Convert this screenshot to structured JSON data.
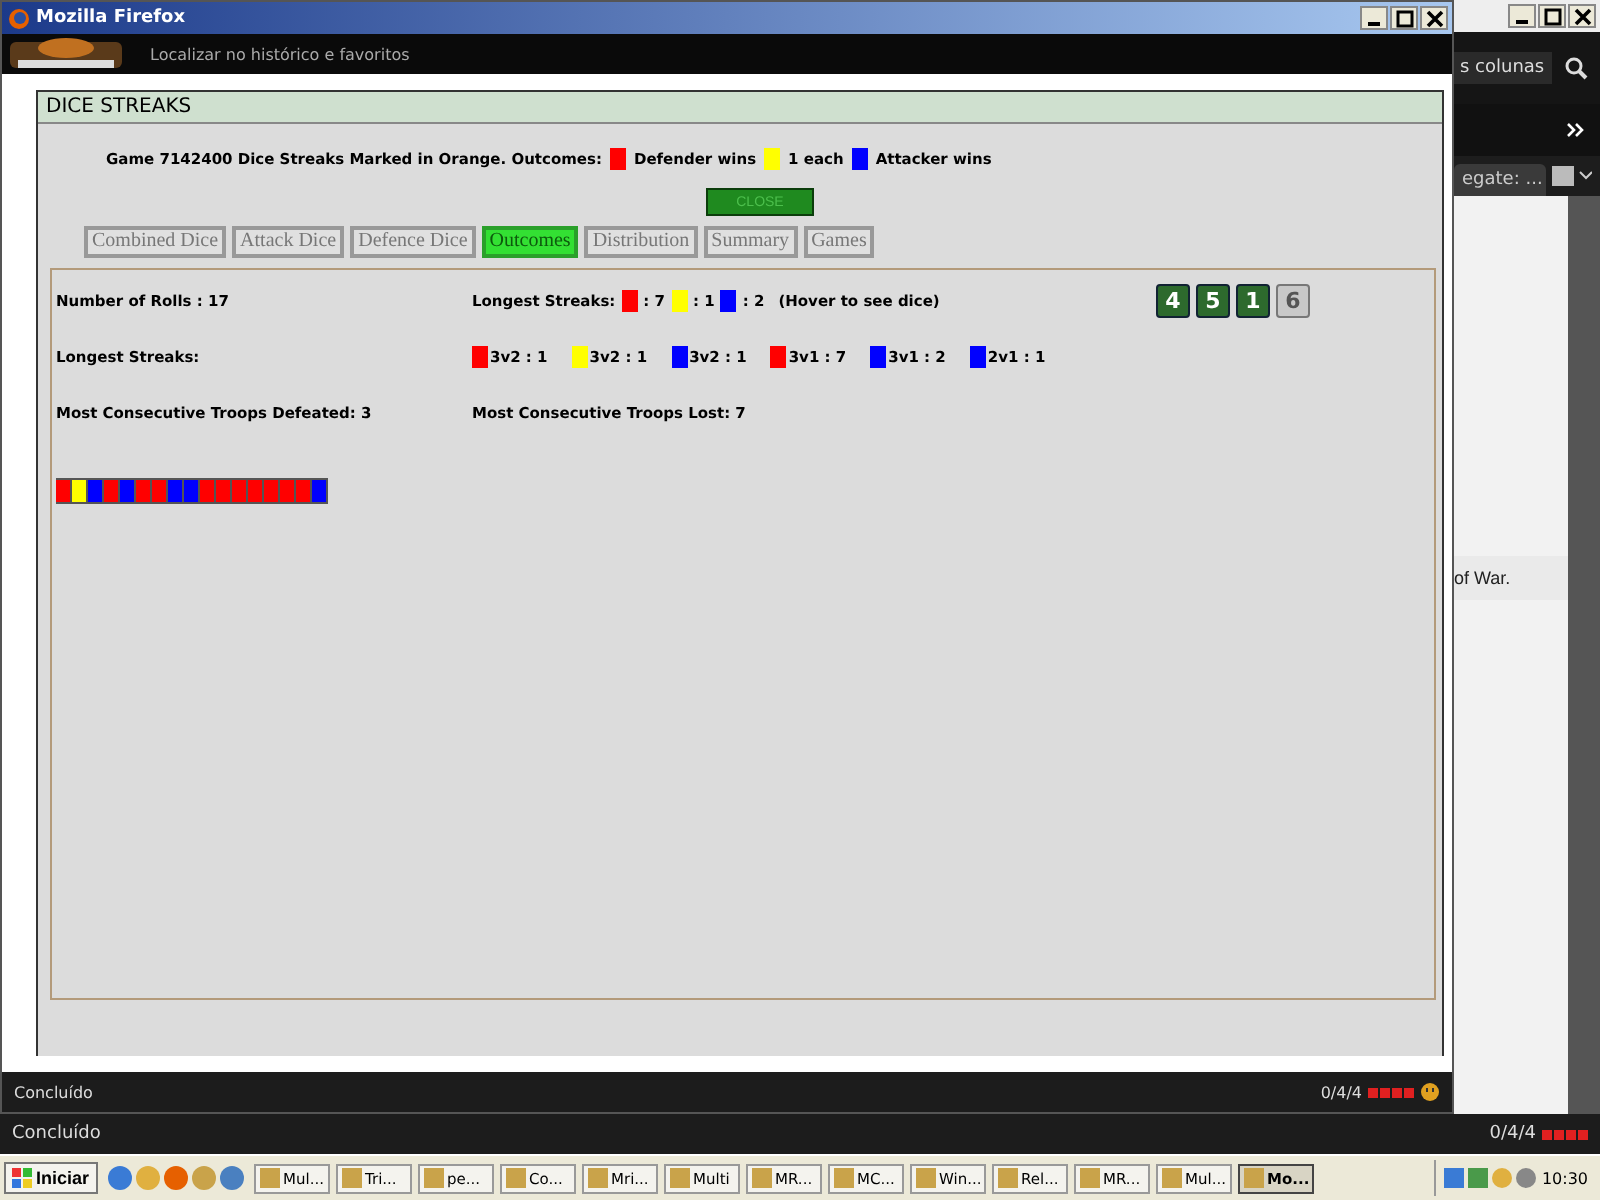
{
  "popup": {
    "title": "Mozilla Firefox",
    "address_placeholder": "Localizar no histórico e favoritos",
    "dialog": {
      "heading": "DICE STREAKS",
      "intro": "Game 7142400 Dice Streaks Marked in Orange. Outcomes:",
      "legend": [
        {
          "label": "Defender wins",
          "color": "#ff0000"
        },
        {
          "label": "1 each",
          "color": "#ffff00"
        },
        {
          "label": "Attacker wins",
          "color": "#0000ff"
        }
      ],
      "close": "CLOSE",
      "tabs": [
        {
          "label": "Combined Dice",
          "selected": false
        },
        {
          "label": "Attack Dice",
          "selected": false
        },
        {
          "label": "Defence Dice",
          "selected": false
        },
        {
          "label": "Outcomes",
          "selected": true
        },
        {
          "label": "Distribution",
          "selected": false
        },
        {
          "label": "Summary",
          "selected": false
        },
        {
          "label": "Games",
          "selected": false
        }
      ],
      "rolls": "Number of Rolls : 17",
      "streaks_label": "Longest Streaks:",
      "streaks": [
        {
          "color": "#ff0000",
          "label": ": 7"
        },
        {
          "color": "#ffff00",
          "label": ": 1"
        },
        {
          "color": "#0000ff",
          "label": ": 2"
        }
      ],
      "hover_note": "(Hover to see dice)",
      "dice": [
        {
          "value": "4",
          "kind": "green"
        },
        {
          "value": "5",
          "kind": "green"
        },
        {
          "value": "1",
          "kind": "green"
        },
        {
          "value": "6",
          "kind": "grey"
        }
      ],
      "matchup_label": "Longest Streaks:",
      "matchups": [
        {
          "color": "#ff0000",
          "label": "3v2 : 1"
        },
        {
          "color": "#ffff00",
          "label": "3v2 : 1"
        },
        {
          "color": "#0000ff",
          "label": "3v2 : 1"
        },
        {
          "color": "#ff0000",
          "label": "3v1 : 7"
        },
        {
          "color": "#0000ff",
          "label": "3v1 : 2"
        },
        {
          "color": "#0000ff",
          "label": "2v1 : 1"
        }
      ],
      "defeated": "Most Consecutive Troops Defeated: 3",
      "lost": "Most Consecutive Troops Lost: 7",
      "outcomes": [
        {
          "color": "#ff0000"
        },
        {
          "color": "#ffff00"
        },
        {
          "color": "#0000ff"
        },
        {
          "color": "#ff0000"
        },
        {
          "color": "#0000ff"
        },
        {
          "color": "#ff0000"
        },
        {
          "color": "#ff0000"
        },
        {
          "color": "#0000ff"
        },
        {
          "color": "#0000ff"
        },
        {
          "color": "#ff0000"
        },
        {
          "color": "#ff0000"
        },
        {
          "color": "#ff0000"
        },
        {
          "color": "#ff0000"
        },
        {
          "color": "#ff0000"
        },
        {
          "color": "#ff0000"
        },
        {
          "color": "#ff0000"
        },
        {
          "color": "#0000ff"
        }
      ]
    },
    "status": "Concluído",
    "counter": "0/4/4"
  },
  "background_browser": {
    "search_value": "s colunas",
    "tab": "egate: ...",
    "text": "of War.",
    "status": "Concluído",
    "counter": "0/4/4"
  },
  "taskbar": {
    "start": "Iniciar",
    "items": [
      {
        "label": "Mul...",
        "selected": false
      },
      {
        "label": "Tri...",
        "selected": false
      },
      {
        "label": "pe...",
        "selected": false
      },
      {
        "label": "Co...",
        "selected": false
      },
      {
        "label": "Mri...",
        "selected": false
      },
      {
        "label": "Multi",
        "selected": false
      },
      {
        "label": "MR...",
        "selected": false
      },
      {
        "label": "MC...",
        "selected": false
      },
      {
        "label": "Win...",
        "selected": false
      },
      {
        "label": "Rel...",
        "selected": false
      },
      {
        "label": "MR...",
        "selected": false
      },
      {
        "label": "Mul...",
        "selected": false
      },
      {
        "label": "Mo...",
        "selected": true
      }
    ],
    "clock": "10:30"
  }
}
